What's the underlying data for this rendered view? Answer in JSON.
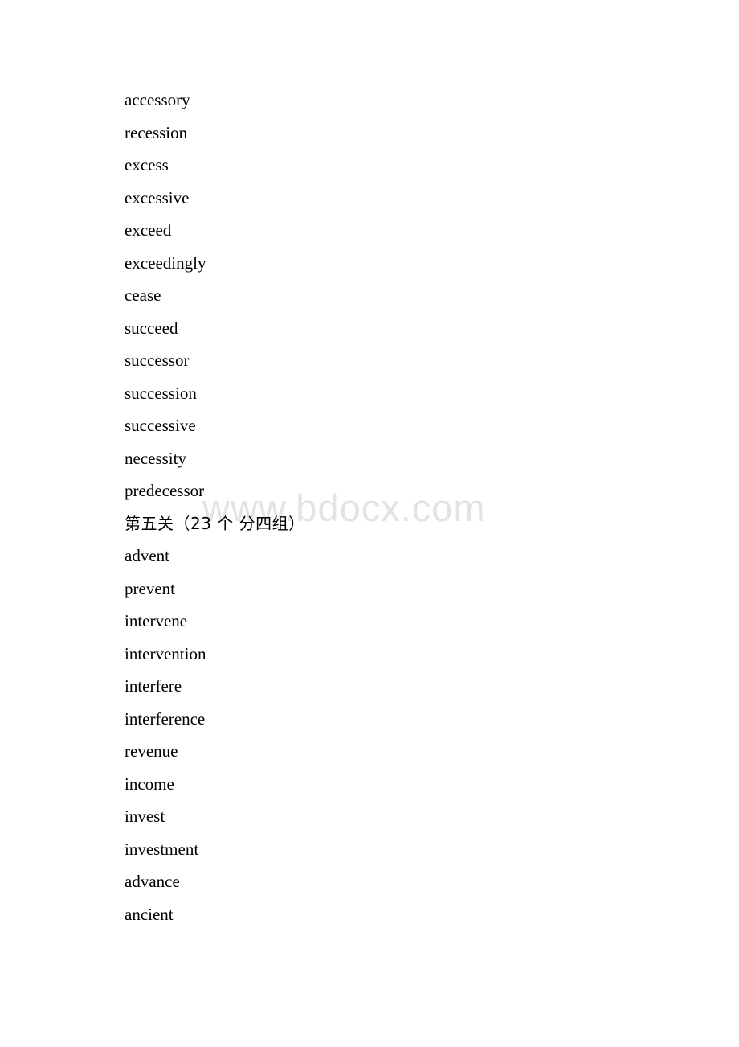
{
  "document": {
    "background_color": "#ffffff",
    "text_color": "#000000",
    "watermark": {
      "text": "www.bdocx.com",
      "color": "#e3e3e5"
    }
  },
  "lines": [
    {
      "type": "word",
      "text": "accessory"
    },
    {
      "type": "word",
      "text": "recession"
    },
    {
      "type": "word",
      "text": "excess"
    },
    {
      "type": "word",
      "text": "excessive"
    },
    {
      "type": "word",
      "text": "exceed"
    },
    {
      "type": "word",
      "text": "exceedingly"
    },
    {
      "type": "word",
      "text": "cease"
    },
    {
      "type": "word",
      "text": "succeed"
    },
    {
      "type": "word",
      "text": "successor"
    },
    {
      "type": "word",
      "text": "succession"
    },
    {
      "type": "word",
      "text": "successive"
    },
    {
      "type": "word",
      "text": "necessity"
    },
    {
      "type": "word",
      "text": "predecessor"
    },
    {
      "type": "heading",
      "text": "第五关（23 个 分四组）"
    },
    {
      "type": "word",
      "text": "advent"
    },
    {
      "type": "word",
      "text": "prevent"
    },
    {
      "type": "word",
      "text": "intervene"
    },
    {
      "type": "word",
      "text": "intervention"
    },
    {
      "type": "word",
      "text": "interfere"
    },
    {
      "type": "word",
      "text": "interference"
    },
    {
      "type": "word",
      "text": "revenue"
    },
    {
      "type": "word",
      "text": "income"
    },
    {
      "type": "word",
      "text": "invest"
    },
    {
      "type": "word",
      "text": "investment"
    },
    {
      "type": "word",
      "text": "advance"
    },
    {
      "type": "word",
      "text": "ancient"
    }
  ]
}
